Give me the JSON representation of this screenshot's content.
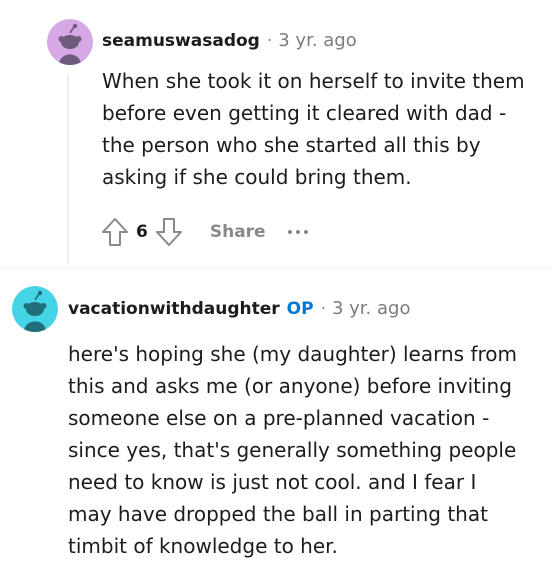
{
  "comments": [
    {
      "username": "seamuswasadog",
      "separator": "·",
      "timestamp": "3 yr. ago",
      "avatar_color": "#d6a8e6",
      "lines": [
        "When she took it on herself to invite them",
        "before even getting it cleared with dad -",
        "the person who she started all this by",
        "asking if she could bring them."
      ],
      "vote_count": "6",
      "share_label": "Share",
      "upvote_icon": "upvote-arrow-icon",
      "downvote_icon": "downvote-arrow-icon",
      "more_icon": "ellipsis-icon"
    },
    {
      "username": "vacationwithdaughter",
      "op_badge": "OP",
      "separator": "·",
      "timestamp": "3 yr. ago",
      "avatar_color": "#45d3e6",
      "lines": [
        "here's hoping she (my daughter) learns from",
        "this and asks me (or anyone) before inviting",
        "someone else on a pre-planned vacation -",
        "since yes, that's generally something people",
        "need to know is just not cool. and I fear I",
        "may have dropped the ball in parting that",
        "timbit of knowledge to her."
      ]
    }
  ],
  "colors": {
    "op_badge": "#0079d3",
    "meta_text": "#7c7c7c",
    "body_text": "#1c1c1c",
    "action_text": "#878a8c"
  }
}
